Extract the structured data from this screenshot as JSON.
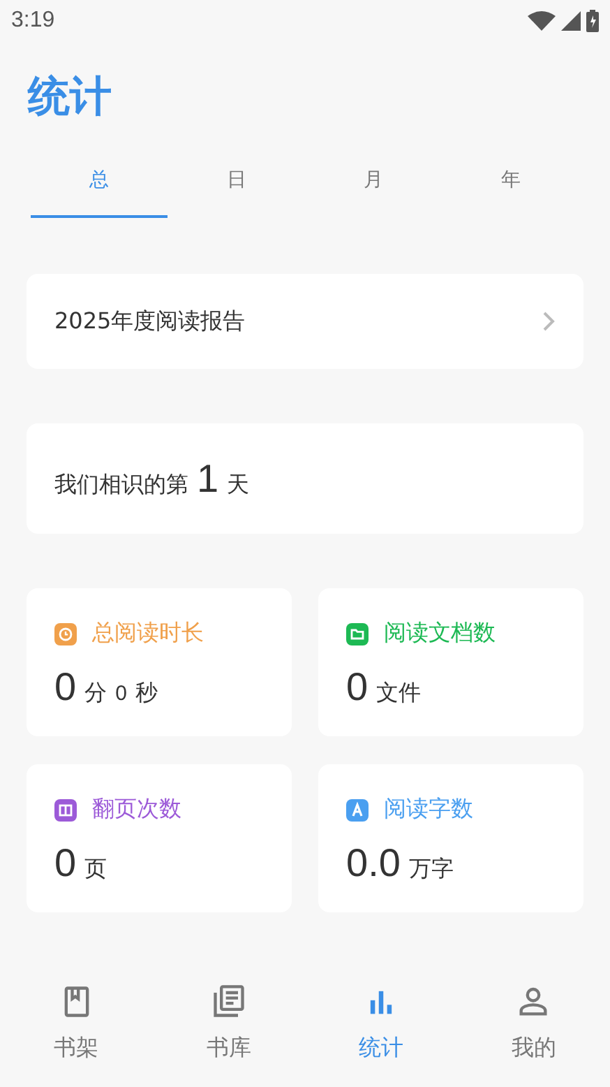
{
  "status_bar": {
    "time": "3:19"
  },
  "title": "统计",
  "tabs": [
    {
      "label": "总",
      "selected": true
    },
    {
      "label": "日",
      "selected": false
    },
    {
      "label": "月",
      "selected": false
    },
    {
      "label": "年",
      "selected": false
    }
  ],
  "report": {
    "label": "2025年度阅读报告"
  },
  "meet": {
    "parts": [
      {
        "text": "我们相识的第",
        "kind": "unit"
      },
      {
        "text": "1",
        "kind": "number"
      },
      {
        "text": "天",
        "kind": "unit"
      }
    ]
  },
  "stats": [
    {
      "label": "总阅读时长",
      "kind": "clock",
      "color": "#f0a04b",
      "parts": [
        {
          "text": "0",
          "kind": "number"
        },
        {
          "text": "分",
          "kind": "unit"
        },
        {
          "text": "0",
          "kind": "small"
        },
        {
          "text": "秒",
          "kind": "unit"
        }
      ]
    },
    {
      "label": "阅读文档数",
      "kind": "folder",
      "color": "#1db954",
      "parts": [
        {
          "text": "0",
          "kind": "number"
        },
        {
          "text": "文件",
          "kind": "unit"
        }
      ]
    },
    {
      "label": "翻页次数",
      "kind": "pages",
      "color": "#9c5ad8",
      "parts": [
        {
          "text": "0",
          "kind": "number"
        },
        {
          "text": "页",
          "kind": "unit"
        }
      ]
    },
    {
      "label": "阅读字数",
      "kind": "letter",
      "color": "#4a9ff0",
      "parts": [
        {
          "text": "0.0",
          "kind": "number"
        },
        {
          "text": "万字",
          "kind": "unit"
        }
      ]
    }
  ],
  "nav": [
    {
      "label": "书架",
      "kind": "book",
      "selected": false
    },
    {
      "label": "书库",
      "kind": "library",
      "selected": false
    },
    {
      "label": "统计",
      "kind": "chart",
      "selected": true
    },
    {
      "label": "我的",
      "kind": "person",
      "selected": false
    }
  ]
}
